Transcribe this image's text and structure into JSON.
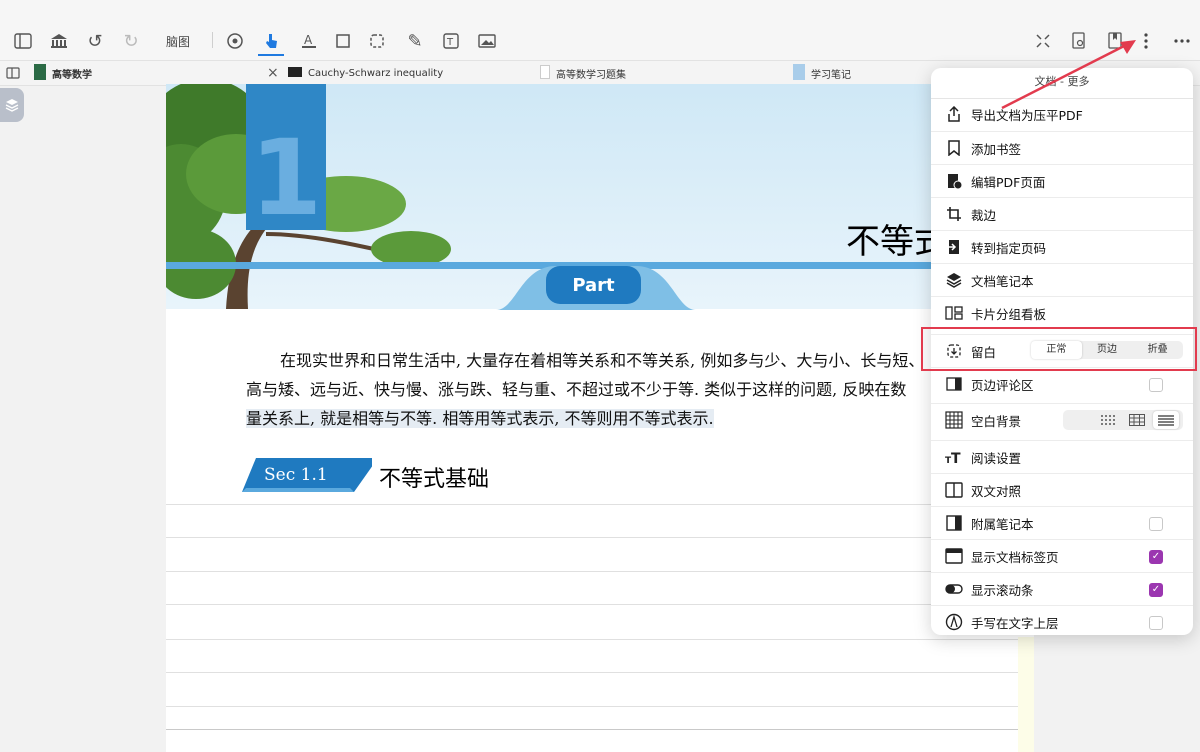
{
  "toolbar": {
    "mindmap_label": "脑图"
  },
  "tabs": [
    {
      "label": "高等数学",
      "active": true
    },
    {
      "label": "Cauchy-Schwarz inequality"
    },
    {
      "label": "高等数学习题集"
    },
    {
      "label": "学习笔记"
    }
  ],
  "document": {
    "chapter_number": "1",
    "part_label": "Part",
    "chapter_title": "不等式",
    "paragraph_line1": "在现实世界和日常生活中, 大量存在着相等关系和不等关系, 例如多与少、大与小、长与短、",
    "paragraph_line2": "高与矮、远与近、快与慢、涨与跌、轻与重、不超过或不少于等. 类似于这样的问题, 反映在数",
    "paragraph_line3": "量关系上, 就是相等与不等. 相等用等式表示, 不等则用不等式表示.",
    "section_badge": "Sec 1.1",
    "section_title": "不等式基础"
  },
  "menu": {
    "title": "文档 - 更多",
    "items": [
      {
        "label": "导出文档为压平PDF",
        "icon": "share-icon"
      },
      {
        "label": "添加书签",
        "icon": "bookmark-icon"
      },
      {
        "label": "编辑PDF页面",
        "icon": "edit-pdf-icon"
      },
      {
        "label": "裁边",
        "icon": "crop-icon"
      },
      {
        "label": "转到指定页码",
        "icon": "goto-page-icon"
      },
      {
        "label": "文档笔记本",
        "icon": "layers-icon"
      },
      {
        "label": "卡片分组看板",
        "icon": "board-icon"
      },
      {
        "label": "留白",
        "icon": "margin-icon"
      },
      {
        "label": "页边评论区",
        "icon": "margin-comment-icon"
      },
      {
        "label": "空白背景",
        "icon": "grid-icon"
      },
      {
        "label": "阅读设置",
        "icon": "text-size-icon"
      },
      {
        "label": "双文对照",
        "icon": "split-view-icon"
      },
      {
        "label": "附属笔记本",
        "icon": "side-notebook-icon"
      },
      {
        "label": "显示文档标签页",
        "icon": "tabs-icon"
      },
      {
        "label": "显示滚动条",
        "icon": "scrollbar-icon"
      },
      {
        "label": "手写在文字上层",
        "icon": "pen-circle-icon"
      }
    ],
    "margin_options": [
      "正常",
      "页边",
      "折叠"
    ],
    "margin_selected": "正常",
    "checks": {
      "margin_comment": false,
      "side_notebook": false,
      "show_tabs": true,
      "show_scrollbar": true,
      "handwrite_above": false
    }
  },
  "colors": {
    "accent": "#1f7ae0",
    "check": "#9b36b0",
    "highlight_box": "#e23b4e"
  }
}
